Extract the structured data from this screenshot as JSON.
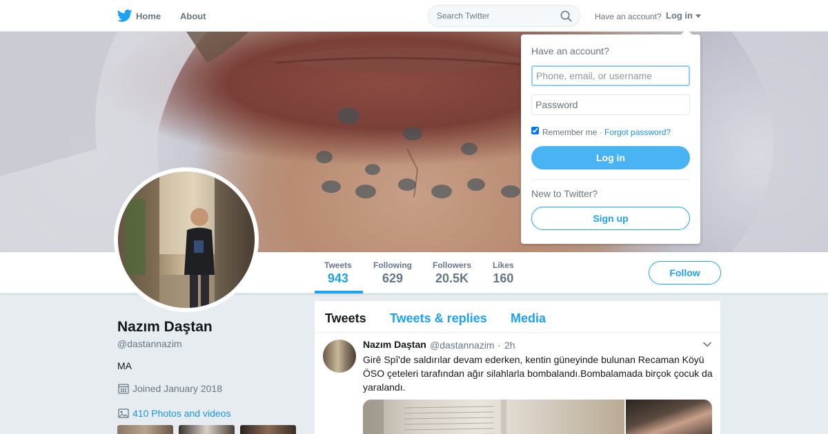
{
  "nav": {
    "home_label": "Home",
    "about_label": "About",
    "search_placeholder": "Search Twitter",
    "have_account_label": "Have an account?",
    "login_label": "Log in"
  },
  "profile": {
    "name": "Nazım Daştan",
    "handle": "@dastannazim",
    "bio": "MA",
    "joined": "Joined January 2018",
    "photos_link": "410 Photos and videos",
    "follow_label": "Follow",
    "stats": [
      {
        "label": "Tweets",
        "value": "943"
      },
      {
        "label": "Following",
        "value": "629"
      },
      {
        "label": "Followers",
        "value": "20.5K"
      },
      {
        "label": "Likes",
        "value": "160"
      }
    ]
  },
  "timeline": {
    "tabs": [
      "Tweets",
      "Tweets & replies",
      "Media"
    ],
    "tweet": {
      "name": "Nazım Daştan",
      "handle": "@dastannazim",
      "separator": "·",
      "time": "2h",
      "text": "Girê Spî'de saldırılar devam ederken, kentin güneyinde bulunan Recaman Köyü ÖSO çeteleri tarafından ağır silahlarla bombalandı.Bombalamada birçok çocuk da yaralandı."
    }
  },
  "login_dropdown": {
    "title": "Have an account?",
    "username_placeholder": "Phone, email, or username",
    "password_placeholder": "Password",
    "remember_label": "Remember me",
    "separator": "·",
    "forgot_label": "Forgot password?",
    "login_button": "Log in",
    "new_label": "New to Twitter?",
    "signup_button": "Sign up"
  },
  "colors": {
    "accent": "#1da1f2",
    "login_button_bg": "#4ab3f4",
    "page_bg": "#e6ecf0"
  }
}
